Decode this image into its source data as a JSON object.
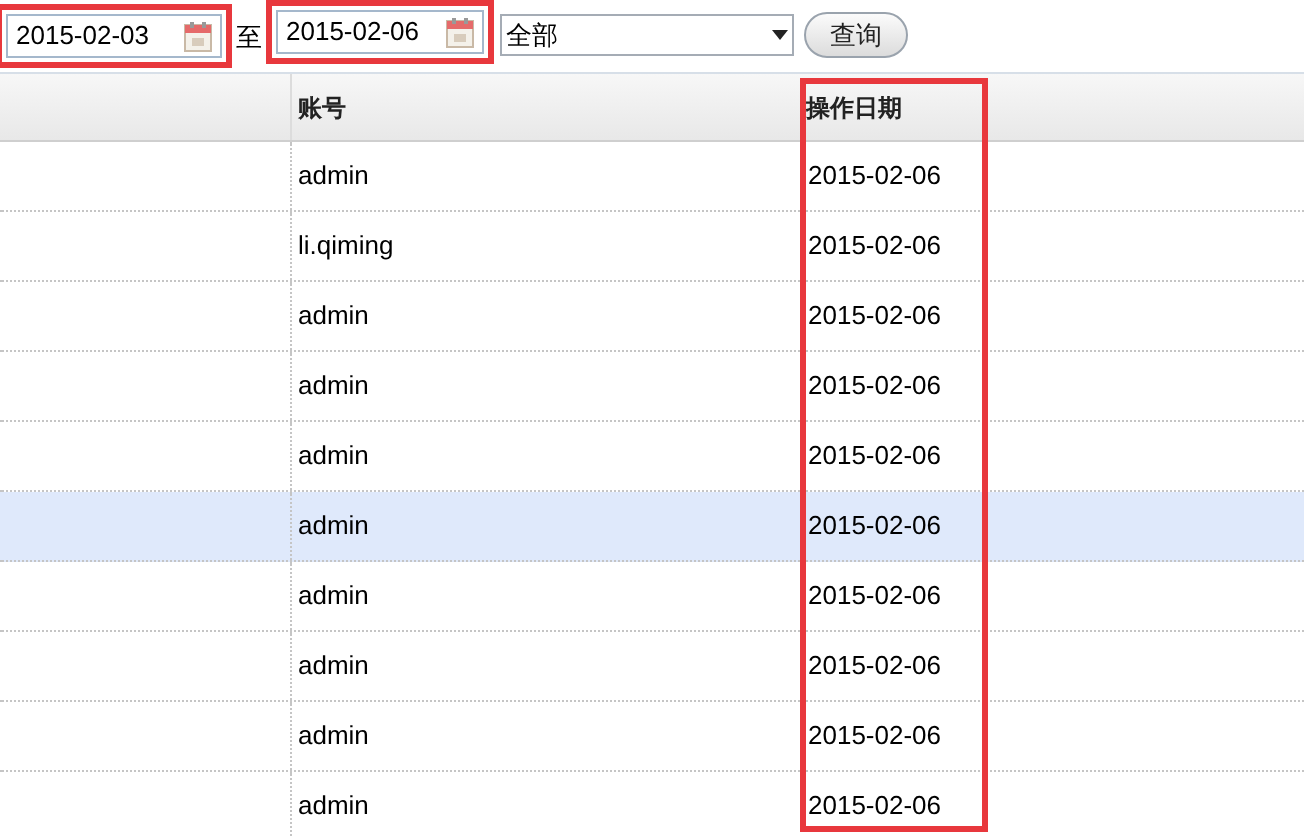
{
  "filter": {
    "from_date": {
      "value": "2015-02-03",
      "highlighted": true
    },
    "separator": "至",
    "to_date": {
      "value": "2015-02-06",
      "highlighted": true
    },
    "type_select": {
      "value": "全部"
    },
    "query_button": "查询"
  },
  "table": {
    "columns": [
      {
        "label": "账号",
        "highlighted": false
      },
      {
        "label": "操作日期",
        "highlighted": true
      }
    ],
    "rows": [
      {
        "account": "admin",
        "date": "2015-02-06",
        "selected": false
      },
      {
        "account": "li.qiming",
        "date": "2015-02-06",
        "selected": false
      },
      {
        "account": "admin",
        "date": "2015-02-06",
        "selected": false
      },
      {
        "account": "admin",
        "date": "2015-02-06",
        "selected": false
      },
      {
        "account": "admin",
        "date": "2015-02-06",
        "selected": false
      },
      {
        "account": "admin",
        "date": "2015-02-06",
        "selected": true
      },
      {
        "account": "admin",
        "date": "2015-02-06",
        "selected": false
      },
      {
        "account": "admin",
        "date": "2015-02-06",
        "selected": false
      },
      {
        "account": "admin",
        "date": "2015-02-06",
        "selected": false
      },
      {
        "account": "admin",
        "date": "2015-02-06",
        "selected": false
      }
    ]
  }
}
